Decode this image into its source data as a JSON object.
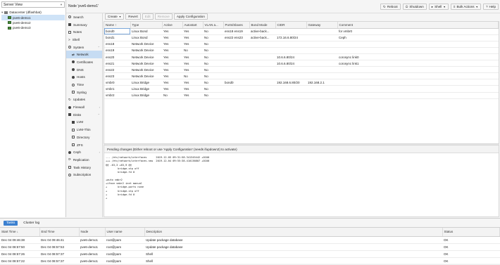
{
  "left": {
    "view_label": "Server View",
    "datacenter": "Datacenter (dflashbat)",
    "nodes": [
      "pve6-demo1",
      "pve6-demo2",
      "pve6-demo3"
    ]
  },
  "header": {
    "title": "Node 'pve6-demo1'",
    "buttons": {
      "reboot": "Reboot",
      "shutdown": "Shutdown",
      "shell": "Shell",
      "bulk": "Bulk Actions",
      "help": "Help"
    }
  },
  "menu": {
    "search": "Search",
    "summary": "Summary",
    "notes": "Notes",
    "shell": "Shell",
    "system": "System",
    "network": "Network",
    "certificates": "Certificates",
    "dns": "DNS",
    "hosts": "Hosts",
    "time": "Time",
    "syslog": "Syslog",
    "updates": "Updates",
    "firewall": "Firewall",
    "disks": "Disks",
    "lvm": "LVM",
    "lvmthin": "LVM-Thin",
    "directory": "Directory",
    "zfs": "ZFS",
    "ceph": "Ceph",
    "replication": "Replication",
    "taskhistory": "Task History",
    "subscription": "Subscription"
  },
  "toolbar": {
    "create": "Create",
    "revert": "Revert",
    "edit": "Edit",
    "remove": "Remove",
    "apply": "Apply Configuration"
  },
  "network": {
    "columns": [
      "Name ↑",
      "Type",
      "Active",
      "Autostart",
      "VLAN a...",
      "Ports/Slaves",
      "Bond Mode",
      "CIDR",
      "Gateway",
      "Comment"
    ],
    "rows": [
      [
        "bond0",
        "Linux Bond",
        "Yes",
        "Yes",
        "No",
        "ens18 ens19",
        "active-back...",
        "",
        "",
        "for vmbr0"
      ],
      [
        "bond1",
        "Linux Bond",
        "Yes",
        "Yes",
        "No",
        "ens22 ens23",
        "active-back...",
        "172.16.6.80/24",
        "",
        "Ceph"
      ],
      [
        "ens18",
        "Network Device",
        "Yes",
        "Yes",
        "No",
        "",
        "",
        "",
        "",
        ""
      ],
      [
        "ens19",
        "Network Device",
        "Yes",
        "No",
        "No",
        "",
        "",
        "",
        "",
        ""
      ],
      [
        "ens20",
        "Network Device",
        "Yes",
        "Yes",
        "No",
        "",
        "",
        "10.6.6.80/24",
        "",
        "corosync link0"
      ],
      [
        "ens21",
        "Network Device",
        "Yes",
        "Yes",
        "No",
        "",
        "",
        "10.6.6.80/24",
        "",
        "corosync link1"
      ],
      [
        "ens22",
        "Network Device",
        "Yes",
        "Yes",
        "No",
        "",
        "",
        "",
        "",
        ""
      ],
      [
        "ens23",
        "Network Device",
        "Yes",
        "No",
        "No",
        "",
        "",
        "",
        "",
        ""
      ],
      [
        "vmbr0",
        "Linux Bridge",
        "Yes",
        "Yes",
        "No",
        "bond0",
        "",
        "192.168.6.80/20",
        "192.168.2.1",
        ""
      ],
      [
        "vmbr1",
        "Linux Bridge",
        "Yes",
        "Yes",
        "No",
        "",
        "",
        "",
        "",
        ""
      ],
      [
        "vmbr2",
        "Linux Bridge",
        "No",
        "Yes",
        "No",
        "",
        "",
        "",
        "",
        ""
      ]
    ]
  },
  "pending": {
    "title": "Pending changes (Either reboot or use 'Apply Configuration' (needs ifupdown2) to activate)",
    "diff": "--- /etc/network/interfaces      2019-12-05 09:31:58.341345442 +0100\n+++ /etc/network/interfaces.new  2019-12-04 09:55:38.410136807 +0100\n@@ -63,3 +63,9 @@\n        bridge-stp off\n        bridge-fd 0\n\n+auto vmbr2\n+iface vmbr2 inet manual\n+       bridge-ports none\n+       bridge-stp off\n+       bridge-fd 0\n+"
  },
  "bottom": {
    "tabs": [
      "Tasks",
      "Cluster log"
    ],
    "columns": [
      "Start Time ↓",
      "End Time",
      "Node",
      "User name",
      "Description",
      "Status"
    ],
    "rows": [
      [
        "Dec 04 09:46:38",
        "Dec 04 09:46:41",
        "pve6-demo1",
        "root@pam",
        "Update package database",
        "OK"
      ],
      [
        "Dec 04 08:57:50",
        "Dec 04 08:57:53",
        "pve6-demo1",
        "root@pam",
        "Update package database",
        "OK"
      ],
      [
        "Dec 04 08:57:26",
        "Dec 04 08:57:37",
        "pve6-demo1",
        "root@pam",
        "Shell",
        "OK"
      ],
      [
        "Dec 04 08:57:22",
        "Dec 04 08:57:37",
        "pve6-demo1",
        "root@pam",
        "Shell",
        "OK"
      ]
    ]
  }
}
